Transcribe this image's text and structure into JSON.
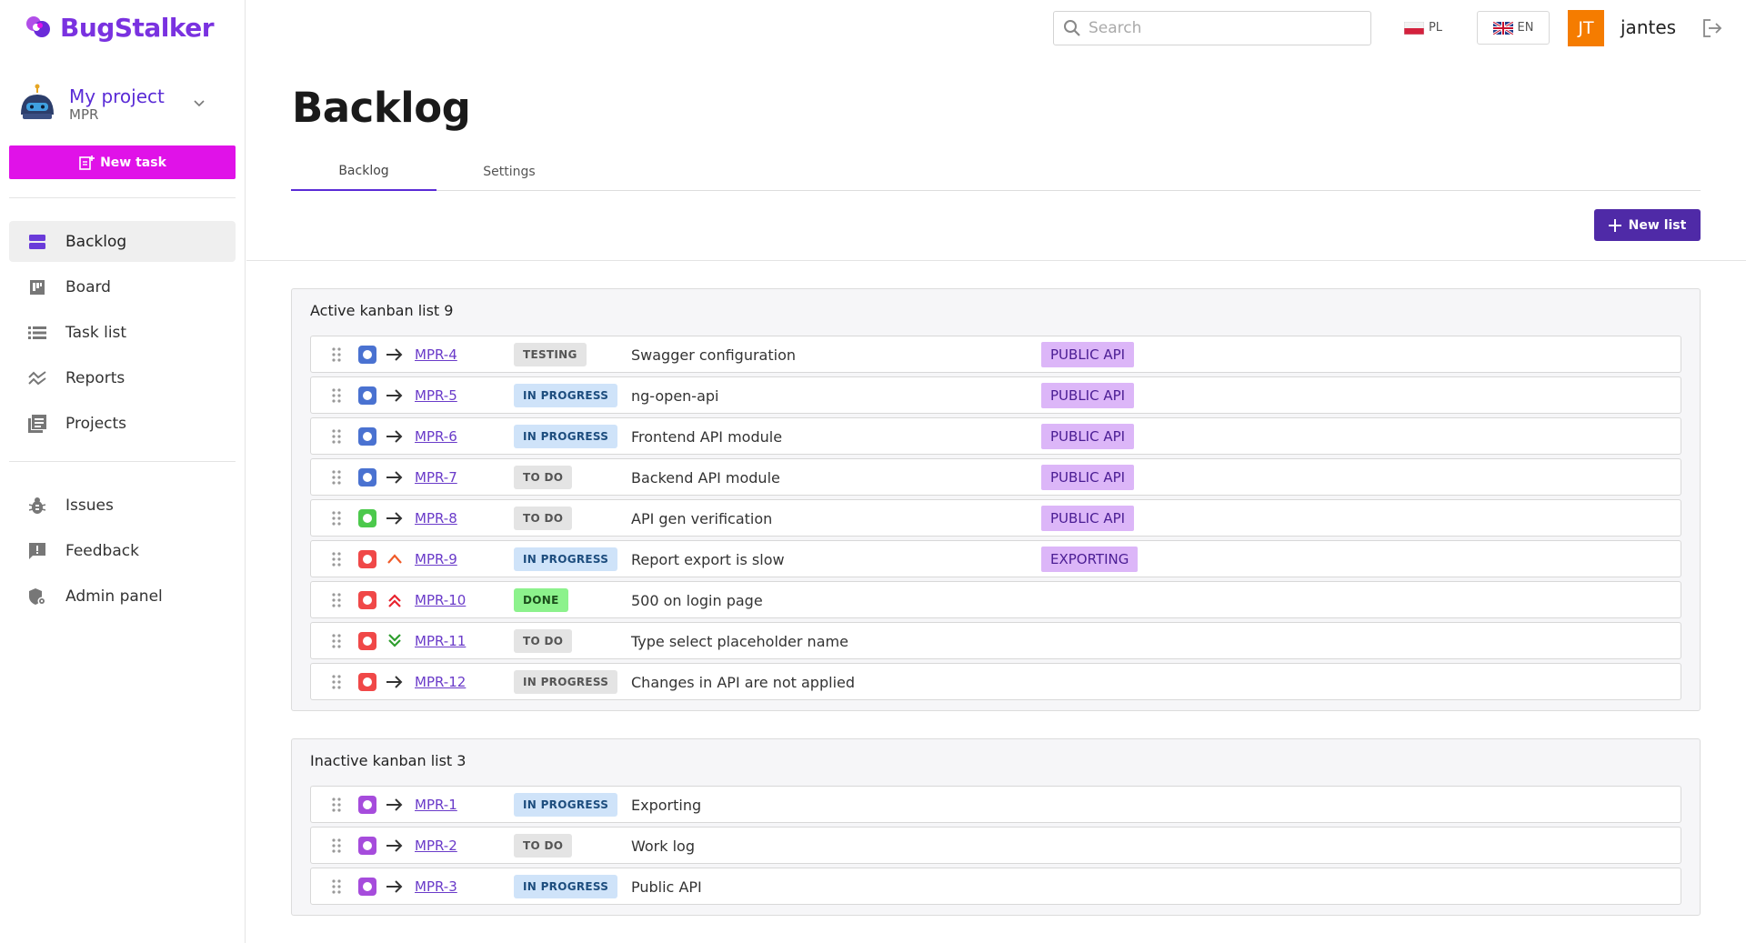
{
  "app": {
    "name": "BugStalker",
    "brand_color": "#7a32e0",
    "accent_color": "#e012e8",
    "primary_button_color": "#4f2aa7"
  },
  "project": {
    "name": "My project",
    "code": "MPR"
  },
  "sidebar": {
    "new_task_label": "New task",
    "nav_main": [
      {
        "label": "Backlog",
        "icon": "backlog-icon",
        "active": true
      },
      {
        "label": "Board",
        "icon": "board-icon",
        "active": false
      },
      {
        "label": "Task list",
        "icon": "task-list-icon",
        "active": false
      },
      {
        "label": "Reports",
        "icon": "reports-icon",
        "active": false
      },
      {
        "label": "Projects",
        "icon": "projects-icon",
        "active": false
      }
    ],
    "nav_secondary": [
      {
        "label": "Issues",
        "icon": "bug-icon"
      },
      {
        "label": "Feedback",
        "icon": "feedback-icon"
      },
      {
        "label": "Admin panel",
        "icon": "admin-shield-icon"
      }
    ]
  },
  "header": {
    "search_placeholder": "Search",
    "lang_pl": "PL",
    "lang_en": "EN",
    "user_initials": "JT",
    "username": "jantes"
  },
  "page": {
    "title": "Backlog",
    "tabs": [
      {
        "label": "Backlog",
        "active": true
      },
      {
        "label": "Settings",
        "active": false
      }
    ],
    "new_list_label": "New list"
  },
  "lists": [
    {
      "title": "Active kanban list 9",
      "rows": [
        {
          "type_color": "#4a72d1",
          "priority": "medium",
          "key": "MPR-4",
          "status": "TESTING",
          "status_class": "st-testing",
          "title": "Swagger configuration",
          "label": "PUBLIC API"
        },
        {
          "type_color": "#4a72d1",
          "priority": "medium",
          "key": "MPR-5",
          "status": "IN PROGRESS",
          "status_class": "st-inprogress",
          "title": "ng-open-api",
          "label": "PUBLIC API"
        },
        {
          "type_color": "#4a72d1",
          "priority": "medium",
          "key": "MPR-6",
          "status": "IN PROGRESS",
          "status_class": "st-inprogress",
          "title": "Frontend API module",
          "label": "PUBLIC API"
        },
        {
          "type_color": "#4a72d1",
          "priority": "medium",
          "key": "MPR-7",
          "status": "TO DO",
          "status_class": "st-todo",
          "title": "Backend API module",
          "label": "PUBLIC API"
        },
        {
          "type_color": "#4cc94c",
          "priority": "medium",
          "key": "MPR-8",
          "status": "TO DO",
          "status_class": "st-todo",
          "title": "API gen verification",
          "label": "PUBLIC API"
        },
        {
          "type_color": "#f04848",
          "priority": "high",
          "key": "MPR-9",
          "status": "IN PROGRESS",
          "status_class": "st-inprogress",
          "title": "Report export is slow",
          "label": "EXPORTING"
        },
        {
          "type_color": "#f04848",
          "priority": "highest",
          "key": "MPR-10",
          "status": "DONE",
          "status_class": "st-done",
          "title": "500 on login page",
          "label": ""
        },
        {
          "type_color": "#f04848",
          "priority": "lowest",
          "key": "MPR-11",
          "status": "TO DO",
          "status_class": "st-todo",
          "title": "Type select placeholder name",
          "label": ""
        },
        {
          "type_color": "#f04848",
          "priority": "medium",
          "key": "MPR-12",
          "status": "IN PROGRESS",
          "status_class": "st-todo",
          "title": "Changes in API are not applied",
          "label": ""
        }
      ]
    },
    {
      "title": "Inactive kanban list 3",
      "rows": [
        {
          "type_color": "#a64cdc",
          "priority": "medium",
          "key": "MPR-1",
          "status": "IN PROGRESS",
          "status_class": "st-inprogress",
          "title": "Exporting",
          "label": ""
        },
        {
          "type_color": "#a64cdc",
          "priority": "medium",
          "key": "MPR-2",
          "status": "TO DO",
          "status_class": "st-todo",
          "title": "Work log",
          "label": ""
        },
        {
          "type_color": "#a64cdc",
          "priority": "medium",
          "key": "MPR-3",
          "status": "IN PROGRESS",
          "status_class": "st-inprogress",
          "title": "Public API",
          "label": ""
        }
      ]
    }
  ]
}
